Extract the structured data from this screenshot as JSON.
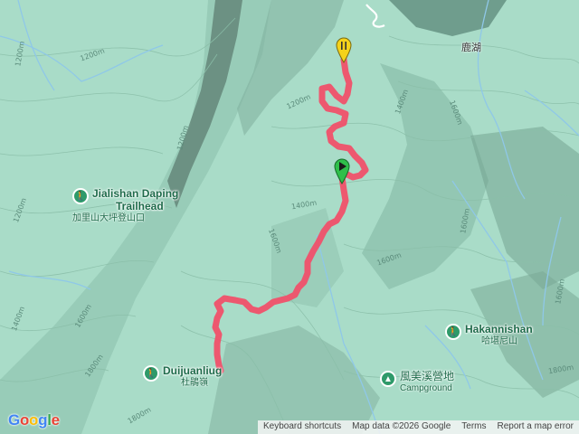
{
  "map": {
    "logo": {
      "letters": [
        "G",
        "o",
        "o",
        "g",
        "l",
        "e"
      ],
      "colors": [
        "#4285F4",
        "#EA4335",
        "#FBBC05",
        "#4285F4",
        "#34A853",
        "#EA4335"
      ]
    },
    "attribution": {
      "keyboard_shortcuts": "Keyboard shortcuts",
      "map_data": "Map data ©2026 Google",
      "terms": "Terms",
      "report": "Report a map error"
    },
    "pois": [
      {
        "name_en": "Jialishan Daping",
        "name_en2": "Trailhead",
        "name_zh": "加里山大坪登山口",
        "icon": "hiker-icon"
      },
      {
        "name_en": "Duijuanliug",
        "name_zh": "杜鵑嶺",
        "icon": "hiker-icon"
      },
      {
        "name_en": "Hakannishan",
        "name_zh": "哈堪尼山",
        "icon": "hiker-icon"
      },
      {
        "name_zh": "風美溪營地",
        "name_en": "Campground",
        "icon": "tent-icon"
      }
    ],
    "place_label": "鹿湖",
    "contour_labels": [
      "1200m",
      "1200m",
      "1200m",
      "1200m",
      "1400m",
      "1400m",
      "1600m",
      "1600m",
      "1600m",
      "1600m",
      "1800m",
      "1800m",
      "2000m",
      "1200m",
      "1400m",
      "1600m",
      "1600m",
      "1800m"
    ],
    "markers": {
      "end": {
        "label": "end-marker",
        "color": "#f5d21b"
      },
      "start": {
        "label": "start-marker",
        "color": "#2fbf4a"
      }
    },
    "track_color": "#f0506a",
    "colors": {
      "terrain": "#a9dcc8",
      "water": "#8fc8e8",
      "poi": "#2f9a6a"
    }
  }
}
